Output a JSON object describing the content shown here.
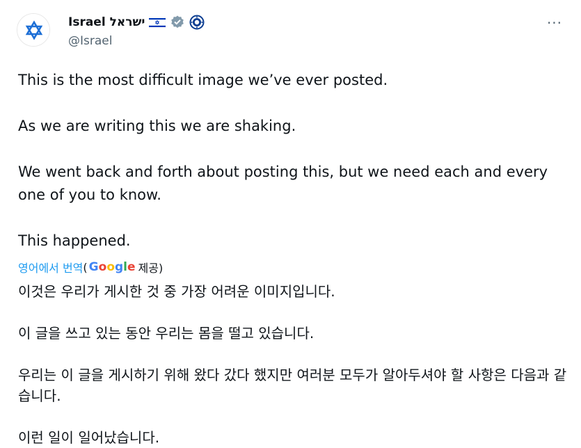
{
  "author": {
    "display_name": "Israel ישראל",
    "handle": "@Israel",
    "avatar_icon": "star-of-david-icon",
    "flag_icon": "israel-flag-icon",
    "verified_icon": "verified-badge-icon",
    "affiliate_icon": "government-seal-icon",
    "brand_blue": "#0038b8"
  },
  "more_label": "···",
  "post": {
    "p1": "This is the most difficult image we’ve ever posted.",
    "p2": "As we are writing this we are shaking.",
    "p3": "We went back and forth about posting this, but we need each and every one of you to know.",
    "p4": "This happened."
  },
  "translation": {
    "link_label": "영어에서 번역",
    "open_paren": "(",
    "provider": "Google",
    "provider_letters": [
      "G",
      "o",
      "o",
      "g",
      "l",
      "e"
    ],
    "suffix": "제공)",
    "p1": "이것은 우리가 게시한 것 중 가장 어려운 이미지입니다.",
    "p2": "이 글을 쓰고 있는 동안 우리는 몸을 떨고 있습니다.",
    "p3": "우리는 이 글을 게시하기 위해 왔다 갔다 했지만 여러분 모두가 알아두셔야 할 사항은 다음과 같습니다.",
    "p4": "이런 일이 일어났습니다."
  }
}
